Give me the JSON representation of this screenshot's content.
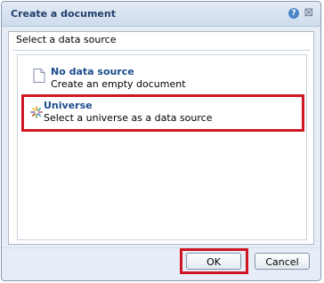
{
  "dialog": {
    "title": "Create a document",
    "help_glyph": "?",
    "close_glyph": "⊠"
  },
  "content": {
    "section_label": "Select a data source",
    "options": [
      {
        "title": "No data source",
        "description": "Create an empty document",
        "icon": "document-icon"
      },
      {
        "title": "Universe",
        "description": "Select a universe as a data source",
        "icon": "universe-icon"
      }
    ]
  },
  "buttons": {
    "ok_label": "OK",
    "cancel_label": "Cancel"
  },
  "colors": {
    "highlight": "#d01622",
    "title_text": "#1f3f6a",
    "option_title": "#1c4c8a"
  }
}
